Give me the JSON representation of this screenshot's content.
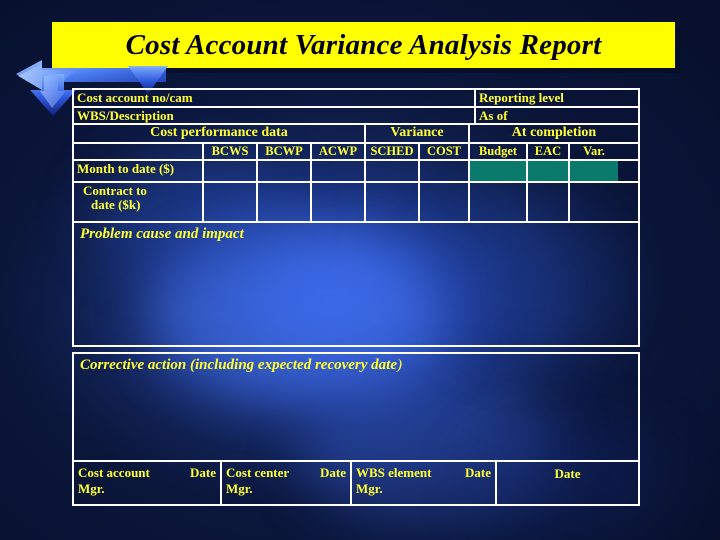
{
  "title": "Cost Account Variance Analysis Report",
  "colors": {
    "banner_bg": "#ffff00",
    "banner_text": "#000000",
    "form_text": "#ffff33",
    "form_border": "#ffffff",
    "highlight_cell": "#0a7a6d",
    "background_dark": "#0c1840",
    "background_center": "#2b56d2"
  },
  "decoration": {
    "arrow": "double-arrow-left-down"
  },
  "form": {
    "identity": [
      {
        "left": "Cost account no/cam",
        "right": "Reporting level"
      },
      {
        "left": "WBS/Description",
        "right": "As of"
      }
    ],
    "group_headers": [
      "Cost performance data",
      "Variance",
      "At completion"
    ],
    "column_headers": [
      "",
      "BCWS",
      "BCWP",
      "ACWP",
      "SCHED",
      "COST",
      "Budget",
      "EAC",
      "Var."
    ],
    "rows": [
      {
        "label": "Month to date ($)",
        "label_line2": "",
        "values": [
          "",
          "",
          "",
          "",
          "",
          "",
          "",
          ""
        ],
        "highlight": [
          false,
          false,
          false,
          false,
          false,
          true,
          true,
          true
        ]
      },
      {
        "label": "Contract to",
        "label_line2": "date  ($k)",
        "values": [
          "",
          "",
          "",
          "",
          "",
          "",
          "",
          ""
        ],
        "highlight": [
          false,
          false,
          false,
          false,
          false,
          false,
          false,
          false
        ]
      }
    ],
    "sections": [
      {
        "title": "Problem cause and impact",
        "title_tail": "",
        "body": ""
      },
      {
        "title": "Corrective action (including expected recovery date",
        "title_tail": ")",
        "body": ""
      }
    ],
    "signatures": [
      {
        "role": "Cost account",
        "date": "Date",
        "mgr": "Mgr."
      },
      {
        "role": "Cost center",
        "date": "Date",
        "mgr": "Mgr."
      },
      {
        "role": "WBS element",
        "date": "Date",
        "mgr": "Mgr."
      },
      {
        "role": "",
        "date": "Date",
        "mgr": ""
      }
    ]
  }
}
